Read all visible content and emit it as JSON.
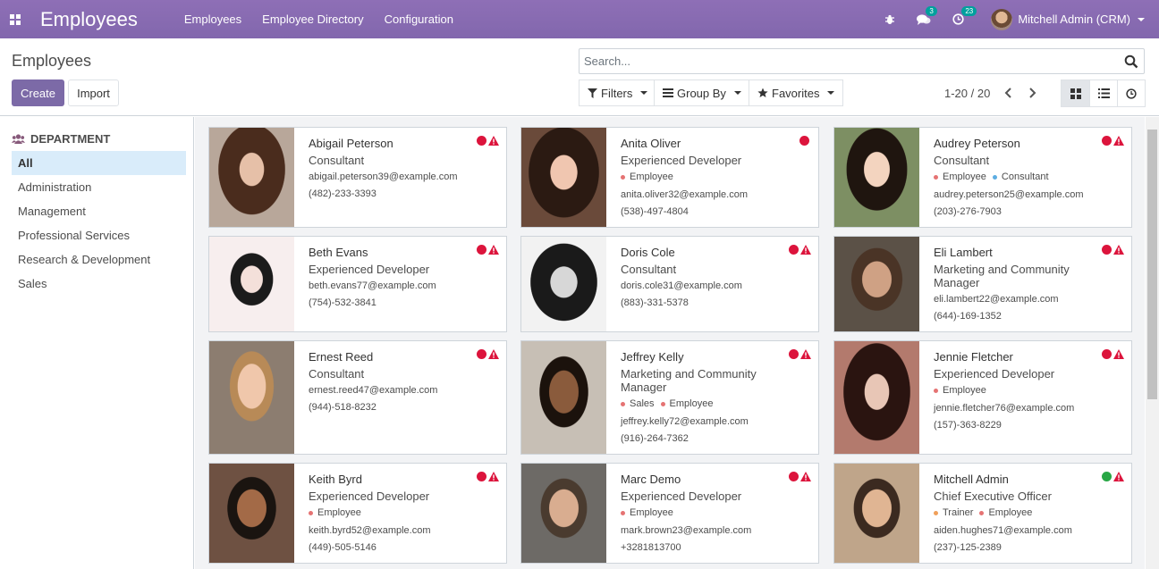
{
  "navbar": {
    "app_title": "Employees",
    "menu": [
      "Employees",
      "Employee Directory",
      "Configuration"
    ],
    "messages_count": "3",
    "activities_count": "23",
    "user_name": "Mitchell Admin (CRM)"
  },
  "control_panel": {
    "breadcrumb": "Employees",
    "create_label": "Create",
    "import_label": "Import",
    "search_placeholder": "Search...",
    "filters_label": "Filters",
    "groupby_label": "Group By",
    "favorites_label": "Favorites",
    "pager": "1-20 / 20"
  },
  "side_panel": {
    "header": "DEPARTMENT",
    "items": [
      "All",
      "Administration",
      "Management",
      "Professional Services",
      "Research & Development",
      "Sales"
    ],
    "active_index": 0
  },
  "colors": {
    "brand": "#875a7b",
    "status_red": "#dc143c",
    "status_green": "#28a745",
    "tag_employee": "#e57373",
    "tag_consultant": "#5dade2",
    "tag_sales": "#e57373",
    "tag_trainer": "#f0a05a"
  },
  "employees": [
    {
      "name": "Abigail Peterson",
      "job": "Consultant",
      "tags": [],
      "email": "abigail.peterson39@example.com",
      "phone": "(482)-233-3393",
      "status": "red",
      "warning": true
    },
    {
      "name": "Anita Oliver",
      "job": "Experienced Developer",
      "tags": [
        "Employee"
      ],
      "email": "anita.oliver32@example.com",
      "phone": "(538)-497-4804",
      "status": "red",
      "warning": false
    },
    {
      "name": "Audrey Peterson",
      "job": "Consultant",
      "tags": [
        "Employee",
        "Consultant"
      ],
      "email": "audrey.peterson25@example.com",
      "phone": "(203)-276-7903",
      "status": "red",
      "warning": true
    },
    {
      "name": "Beth Evans",
      "job": "Experienced Developer",
      "tags": [],
      "email": "beth.evans77@example.com",
      "phone": "(754)-532-3841",
      "status": "red",
      "warning": true
    },
    {
      "name": "Doris Cole",
      "job": "Consultant",
      "tags": [],
      "email": "doris.cole31@example.com",
      "phone": "(883)-331-5378",
      "status": "red",
      "warning": true
    },
    {
      "name": "Eli Lambert",
      "job": "Marketing and Community Manager",
      "tags": [],
      "email": "eli.lambert22@example.com",
      "phone": "(644)-169-1352",
      "status": "red",
      "warning": true
    },
    {
      "name": "Ernest Reed",
      "job": "Consultant",
      "tags": [],
      "email": "ernest.reed47@example.com",
      "phone": "(944)-518-8232",
      "status": "red",
      "warning": true
    },
    {
      "name": "Jeffrey Kelly",
      "job": "Marketing and Community Manager",
      "tags": [
        "Sales",
        "Employee"
      ],
      "email": "jeffrey.kelly72@example.com",
      "phone": "(916)-264-7362",
      "status": "red",
      "warning": true
    },
    {
      "name": "Jennie Fletcher",
      "job": "Experienced Developer",
      "tags": [
        "Employee"
      ],
      "email": "jennie.fletcher76@example.com",
      "phone": "(157)-363-8229",
      "status": "red",
      "warning": true
    },
    {
      "name": "Keith Byrd",
      "job": "Experienced Developer",
      "tags": [
        "Employee"
      ],
      "email": "keith.byrd52@example.com",
      "phone": "(449)-505-5146",
      "status": "red",
      "warning": true
    },
    {
      "name": "Marc Demo",
      "job": "Experienced Developer",
      "tags": [
        "Employee"
      ],
      "email": "mark.brown23@example.com",
      "phone": "+3281813700",
      "status": "red",
      "warning": true
    },
    {
      "name": "Mitchell Admin",
      "job": "Chief Executive Officer",
      "tags": [
        "Trainer",
        "Employee"
      ],
      "email": "aiden.hughes71@example.com",
      "phone": "(237)-125-2389",
      "status": "green",
      "warning": true
    }
  ]
}
